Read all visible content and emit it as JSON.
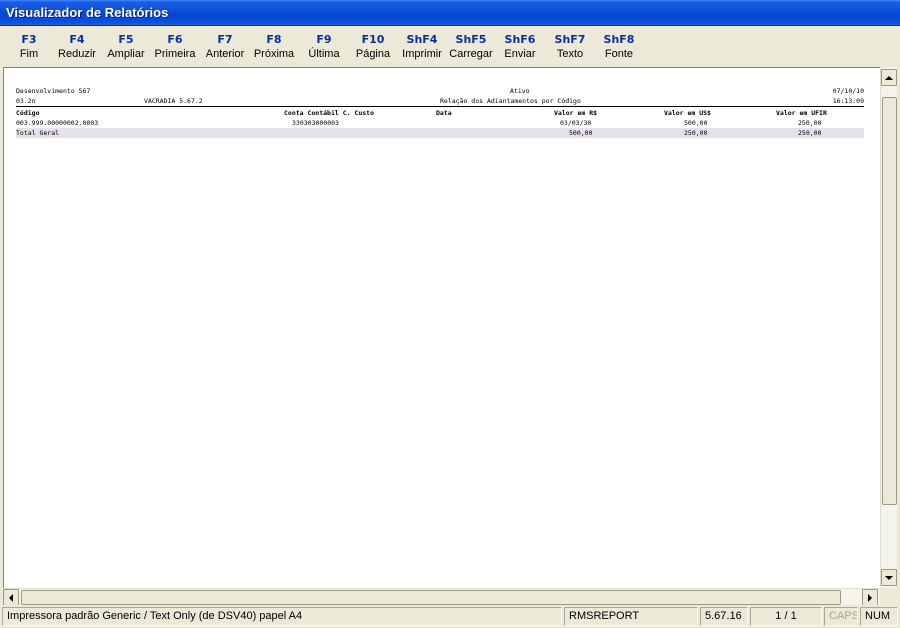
{
  "window": {
    "title": "Visualizador de Relatórios"
  },
  "toolbar": {
    "buttons": [
      {
        "key": "F3",
        "label": "Fim"
      },
      {
        "key": "F4",
        "label": "Reduzir"
      },
      {
        "key": "F5",
        "label": "Ampliar"
      },
      {
        "key": "F6",
        "label": "Primeira"
      },
      {
        "key": "F7",
        "label": "Anterior"
      },
      {
        "key": "F8",
        "label": "Próxima"
      },
      {
        "key": "F9",
        "label": "Última"
      },
      {
        "key": "F10",
        "label": "Página"
      },
      {
        "key": "ShF4",
        "label": "Imprimir"
      },
      {
        "key": "ShF5",
        "label": "Carregar"
      },
      {
        "key": "ShF6",
        "label": "Enviar"
      },
      {
        "key": "ShF7",
        "label": "Texto"
      },
      {
        "key": "ShF8",
        "label": "Fonte"
      }
    ]
  },
  "report": {
    "header": {
      "company": "Desenvolvimento 567",
      "status": "Ativo",
      "date": "07/10/10",
      "code": "03.2n",
      "system": "VACRADIA 5.67.2",
      "report_title": "Relação dos Adiantamentos por Código",
      "time": "16:13:09"
    },
    "columns": [
      "Código",
      "Conta Contábil C. Custo",
      "Data",
      "Valor em R$",
      "Valor em US$",
      "Valor em UFIR"
    ],
    "rows": [
      {
        "codigo": "003.999.00000002.0003",
        "conta": "330303000003",
        "data": "",
        "valor_rs": "03/03/30",
        "valor_us": "500,00",
        "valor_ufir": "250,00"
      }
    ],
    "total": {
      "label": "Total Geral",
      "valor_rs": "500,00",
      "valor_us": "250,00",
      "valor_ufir": "250,00"
    }
  },
  "statusbar": {
    "printer": "Impressora padrão Generic / Text Only (de DSV40) papel A4",
    "module": "RMSREPORT",
    "version": "5.67.16",
    "page": "1 / 1",
    "caps": "CAPS",
    "num": "NUM"
  }
}
